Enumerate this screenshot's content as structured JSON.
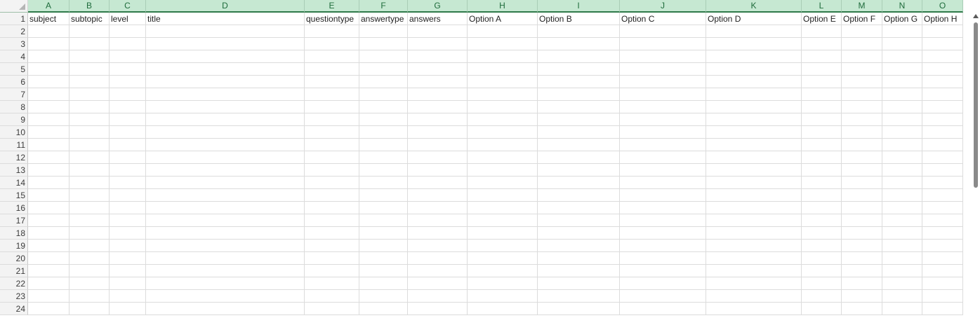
{
  "spreadsheet": {
    "columns": [
      "A",
      "B",
      "C",
      "D",
      "E",
      "F",
      "G",
      "H",
      "I",
      "J",
      "K",
      "L",
      "M",
      "N",
      "O"
    ],
    "rows": [
      "1",
      "2",
      "3",
      "4",
      "5",
      "6",
      "7",
      "8",
      "9",
      "10",
      "11",
      "12",
      "13",
      "14",
      "15",
      "16",
      "17",
      "18",
      "19",
      "20",
      "21",
      "22",
      "23",
      "24"
    ],
    "header_row_values": [
      "subject",
      "subtopic",
      "level",
      "title",
      "questiontype",
      "answertype",
      "answers",
      "Option A",
      "Option B",
      "Option C",
      "Option D",
      "Option E",
      "Option F",
      "Option G",
      "Option H"
    ],
    "colors": {
      "selected_header_fill": "#c6e8d2",
      "selected_header_text": "#1e6b3b",
      "gridline": "#dcdcdc"
    }
  },
  "scrollbar": {
    "up_icon": "triangle-up-icon"
  }
}
